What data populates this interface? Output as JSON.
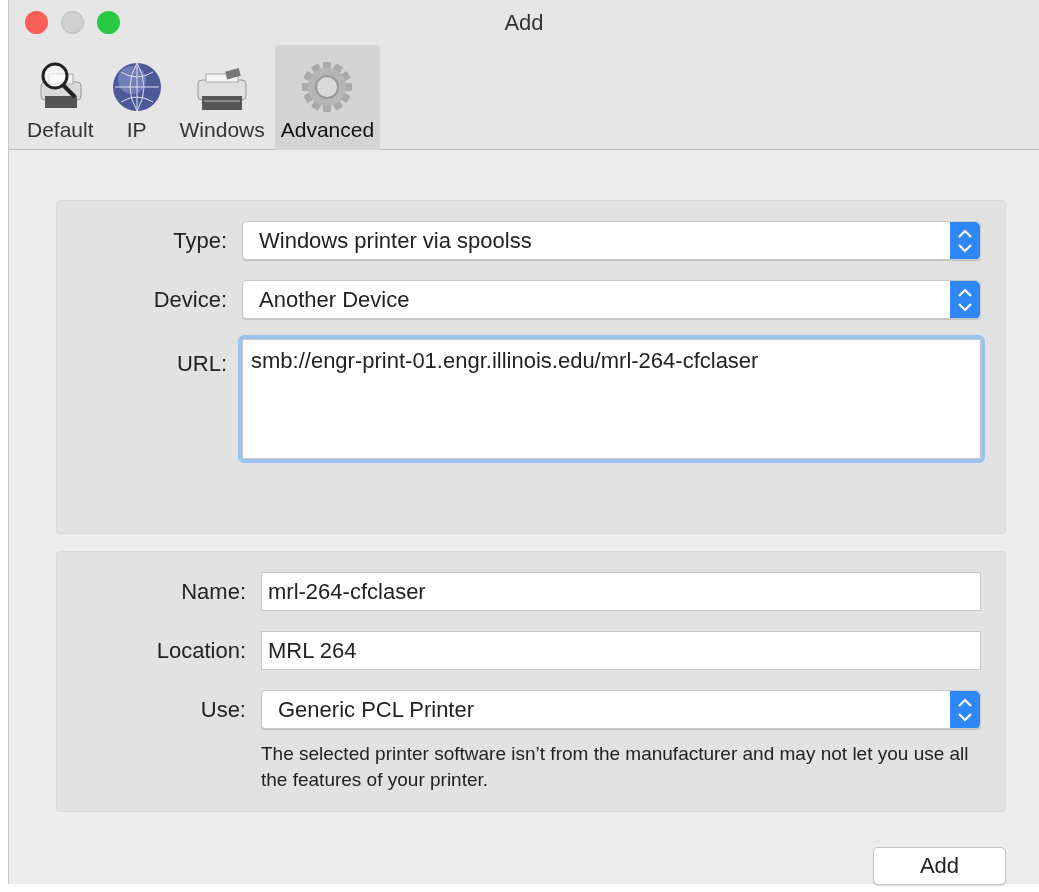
{
  "window": {
    "title": "Add",
    "controls": [
      {
        "kind": "close",
        "disabled": false
      },
      {
        "kind": "minimize",
        "disabled": true
      },
      {
        "kind": "zoom",
        "disabled": false
      }
    ]
  },
  "toolbar": [
    {
      "kind": "default",
      "label": "Default",
      "selected": false
    },
    {
      "kind": "ip",
      "label": "IP",
      "selected": false
    },
    {
      "kind": "windows",
      "label": "Windows",
      "selected": false
    },
    {
      "kind": "advanced",
      "label": "Advanced",
      "selected": true
    }
  ],
  "connection": [
    {
      "kind": "select",
      "label": "Type:",
      "value": "Windows printer via spoolss"
    },
    {
      "kind": "select",
      "label": "Device:",
      "value": "Another Device"
    },
    {
      "kind": "textarea",
      "label": "URL:",
      "value": "smb://engr-print-01.engr.illinois.edu/mrl-264-cfclaser",
      "focused": true
    }
  ],
  "details": [
    {
      "kind": "text",
      "label": "Name:",
      "value": "mrl-264-cfclaser"
    },
    {
      "kind": "text",
      "label": "Location:",
      "value": "MRL 264"
    },
    {
      "kind": "select",
      "label": "Use:",
      "value": "Generic PCL Printer"
    }
  ],
  "note": "The selected printer software isn’t from the manufacturer and may not let you use all the features of your printer.",
  "buttons": [
    {
      "label": "Add"
    }
  ]
}
